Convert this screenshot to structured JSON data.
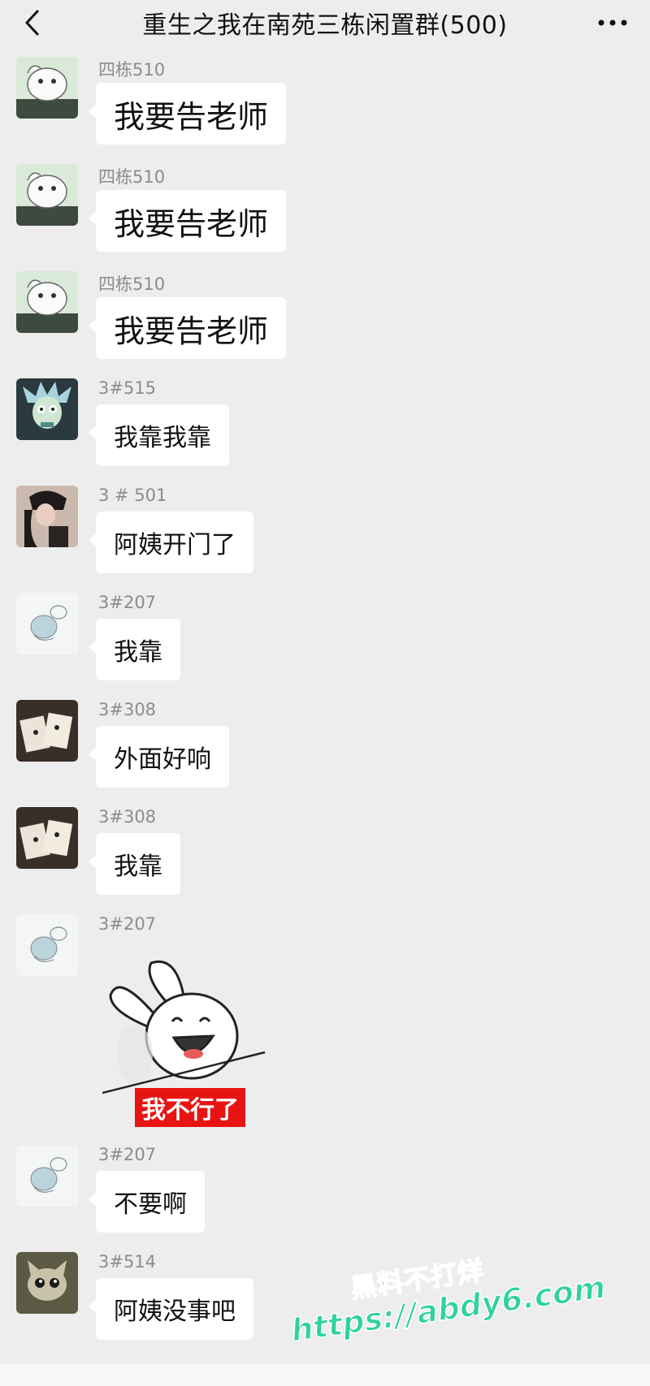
{
  "header": {
    "title": "重生之我在南苑三栋闲置群(500)",
    "back_icon": "chevron-left-icon",
    "more_icon": "more-dots-icon"
  },
  "messages": [
    {
      "sender": "四栋510",
      "text": "我要告老师",
      "avatar": "cartoon-dog-avatar"
    },
    {
      "sender": "四栋510",
      "text": "我要告老师",
      "avatar": "cartoon-dog-avatar"
    },
    {
      "sender": "四栋510",
      "text": "我要告老师",
      "avatar": "cartoon-dog-avatar"
    },
    {
      "sender": "3#515",
      "text": "我靠我靠",
      "avatar": "rick-avatar"
    },
    {
      "sender": "3 # 501",
      "text": "阿姨开门了",
      "avatar": "girl-photo-avatar"
    },
    {
      "sender": "3#207",
      "text": "我靠",
      "avatar": "sketch-cat-avatar"
    },
    {
      "sender": "3#308",
      "text": "外面好响",
      "avatar": "cards-photo-avatar"
    },
    {
      "sender": "3#308",
      "text": "我靠",
      "avatar": "cards-photo-avatar"
    },
    {
      "sender": "3#207",
      "sticker_caption": "我不行了",
      "avatar": "sketch-cat-avatar",
      "sticker": "laughing-rabbit-sticker"
    },
    {
      "sender": "3#207",
      "text": "不要啊",
      "avatar": "sketch-cat-avatar"
    },
    {
      "sender": "3#514",
      "text": "阿姨没事吧",
      "avatar": "cat-toy-avatar"
    }
  ],
  "watermark": {
    "line1": "黑料不打烊",
    "line2": "https://abdy6.com"
  },
  "colors": {
    "background": "#ededed",
    "bubble": "#ffffff",
    "sender_text": "#8c8c8c",
    "sticker_caption_bg": "#e81414",
    "watermark": "#2fd39a"
  }
}
